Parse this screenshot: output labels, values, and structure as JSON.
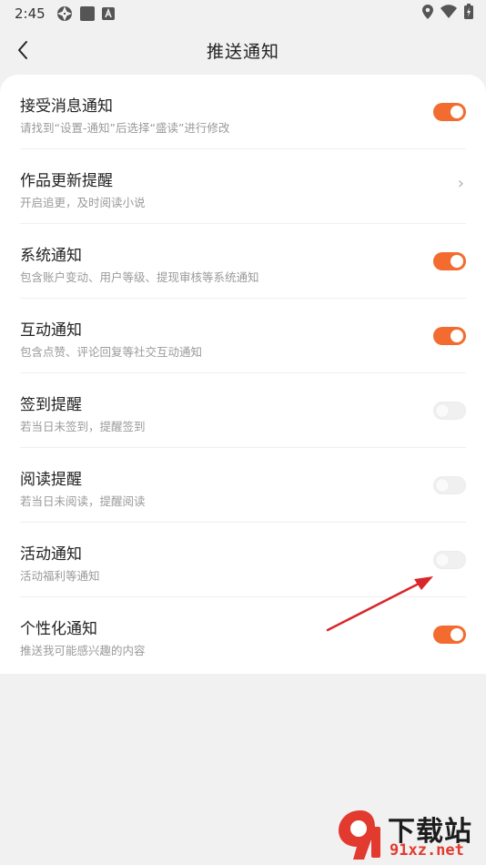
{
  "status_bar": {
    "time": "2:45"
  },
  "header": {
    "title": "推送通知",
    "back_icon": "chevron-left-icon"
  },
  "settings": [
    {
      "title": "接受消息通知",
      "subtitle": "请找到“设置-通知”后选择“盛读”进行修改",
      "control": "toggle",
      "state": "on"
    },
    {
      "title": "作品更新提醒",
      "subtitle": "开启追更，及时阅读小说",
      "control": "chevron",
      "chevron": "›"
    },
    {
      "title": "系统通知",
      "subtitle": "包含账户变动、用户等级、提现审核等系统通知",
      "control": "toggle",
      "state": "on"
    },
    {
      "title": "互动通知",
      "subtitle": "包含点赞、评论回复等社交互动通知",
      "control": "toggle",
      "state": "on"
    },
    {
      "title": "签到提醒",
      "subtitle": "若当日未签到，提醒签到",
      "control": "toggle",
      "state": "off"
    },
    {
      "title": "阅读提醒",
      "subtitle": "若当日未阅读，提醒阅读",
      "control": "toggle",
      "state": "off"
    },
    {
      "title": "活动通知",
      "subtitle": "活动福利等通知",
      "control": "toggle",
      "state": "off"
    },
    {
      "title": "个性化通知",
      "subtitle": "推送我可能感兴趣的内容",
      "control": "toggle",
      "state": "on"
    }
  ],
  "watermark": {
    "top": "下载站",
    "bottom": "91xz.net"
  },
  "colors": {
    "accent": "#f36b2f",
    "annotation_arrow": "#d9262a"
  }
}
